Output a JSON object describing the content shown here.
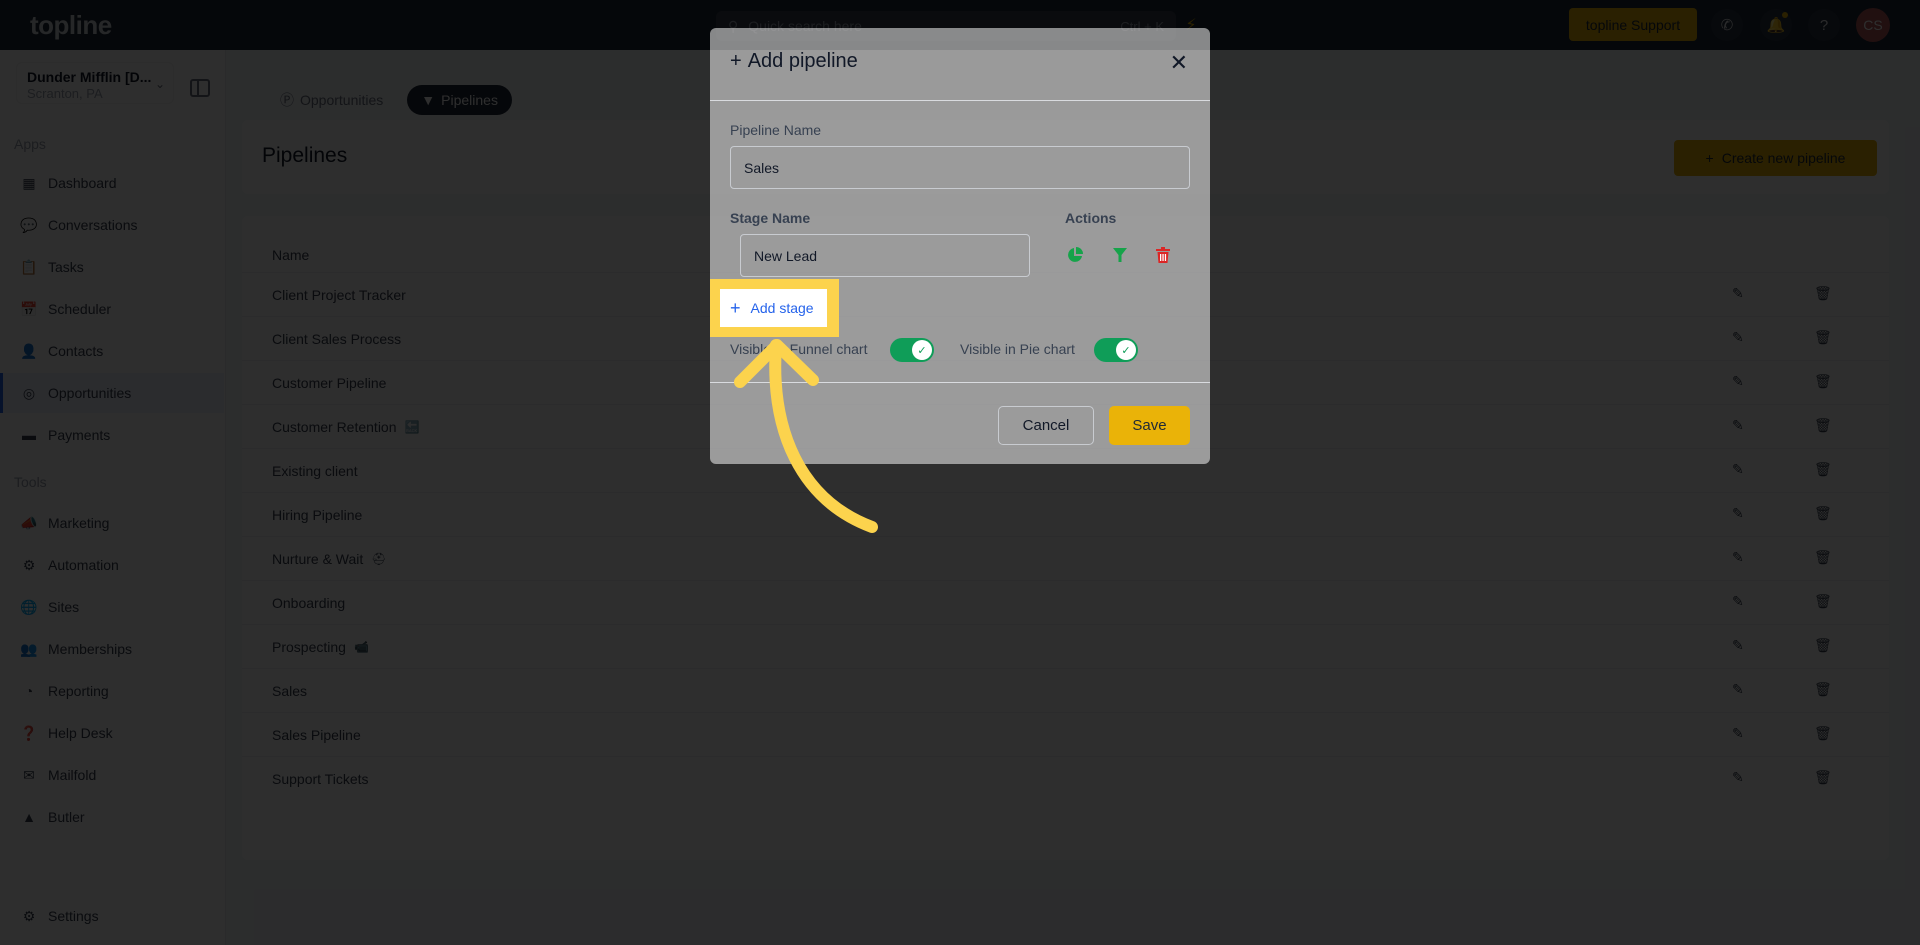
{
  "topbar": {
    "logo": "topline",
    "search_placeholder": "Quick search here",
    "search_shortcut": "Ctrl + K",
    "support_label": "topline Support",
    "avatar_initials": "CS",
    "icons": [
      "bolt-icon",
      "phone-icon",
      "bell-icon",
      "help-icon"
    ]
  },
  "sidebar": {
    "account_name": "Dunder Mifflin [D...",
    "account_location": "Scranton, PA",
    "apps_label": "Apps",
    "tools_label": "Tools",
    "apps": [
      {
        "label": "Dashboard",
        "icon": "dashboard-icon"
      },
      {
        "label": "Conversations",
        "icon": "chat-icon"
      },
      {
        "label": "Tasks",
        "icon": "task-icon"
      },
      {
        "label": "Scheduler",
        "icon": "calendar-icon"
      },
      {
        "label": "Contacts",
        "icon": "person-icon"
      },
      {
        "label": "Opportunities",
        "icon": "target-icon",
        "active": true
      },
      {
        "label": "Payments",
        "icon": "credit-card-icon"
      }
    ],
    "tools": [
      {
        "label": "Marketing",
        "icon": "megaphone-icon"
      },
      {
        "label": "Automation",
        "icon": "gears-icon"
      },
      {
        "label": "Sites",
        "icon": "globe-icon"
      },
      {
        "label": "Memberships",
        "icon": "users-icon"
      },
      {
        "label": "Reporting",
        "icon": "pie-chart-icon"
      },
      {
        "label": "Help Desk",
        "icon": "question-icon"
      },
      {
        "label": "Mailfold",
        "icon": "mail-icon"
      },
      {
        "label": "Butler",
        "icon": "bell-cloche-icon"
      }
    ],
    "settings_label": "Settings"
  },
  "main": {
    "tabs": [
      {
        "label": "Opportunities",
        "active": false
      },
      {
        "label": "Pipelines",
        "active": true
      }
    ],
    "page_title": "Pipelines",
    "create_button": "Create new pipeline",
    "table_header_name": "Name",
    "pipelines": [
      {
        "name": "Client Project Tracker",
        "emoji": ""
      },
      {
        "name": "Client Sales Process",
        "emoji": ""
      },
      {
        "name": "Customer Pipeline",
        "emoji": ""
      },
      {
        "name": "Customer Retention",
        "emoji": "🔙"
      },
      {
        "name": "Existing client",
        "emoji": ""
      },
      {
        "name": "Hiring Pipeline",
        "emoji": ""
      },
      {
        "name": "Nurture & Wait",
        "emoji": "⛑"
      },
      {
        "name": "Onboarding",
        "emoji": ""
      },
      {
        "name": "Prospecting",
        "emoji": "📹"
      },
      {
        "name": "Sales",
        "emoji": ""
      },
      {
        "name": "Sales Pipeline",
        "emoji": ""
      },
      {
        "name": "Support Tickets",
        "emoji": ""
      }
    ]
  },
  "modal": {
    "title": "Add pipeline",
    "pipeline_name_label": "Pipeline Name",
    "pipeline_name_value": "Sales",
    "stage_name_label": "Stage Name",
    "actions_label": "Actions",
    "stage_value": "New Lead",
    "add_stage_label": "Add stage",
    "funnel_toggle_label": "Visible in Funnel chart",
    "funnel_toggle_on": true,
    "pie_toggle_label": "Visible in Pie chart",
    "pie_toggle_on": true,
    "cancel_label": "Cancel",
    "save_label": "Save"
  },
  "colors": {
    "accent_yellow": "#eab308",
    "highlight_yellow": "#fcd34d",
    "link_blue": "#2563eb",
    "toggle_green": "#0f9d58",
    "action_green": "#16a34a",
    "action_red": "#dc2626"
  }
}
